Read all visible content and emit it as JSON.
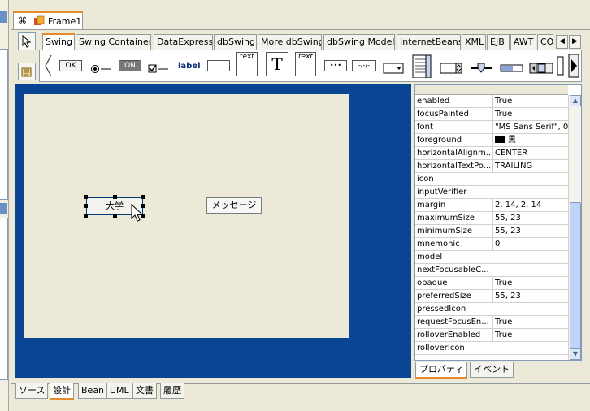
{
  "window": {
    "tab_title": "Frame1"
  },
  "palette_tabs": [
    {
      "label": "Swing",
      "active": true
    },
    {
      "label": "Swing Containers"
    },
    {
      "label": "DataExpress"
    },
    {
      "label": "dbSwing"
    },
    {
      "label": "More dbSwing"
    },
    {
      "label": "dbSwing Models"
    },
    {
      "label": "InternetBeans"
    },
    {
      "label": "XML"
    },
    {
      "label": "EJB"
    },
    {
      "label": "AWT"
    },
    {
      "label": "CO"
    }
  ],
  "palette": {
    "ok": "OK",
    "on": "ON",
    "label": "label",
    "text_field": "text",
    "text_pane": "text",
    "password": "•••",
    "formatted": "-/-/-",
    "big_t": "T"
  },
  "canvas": {
    "button_university": "大学",
    "button_message": "メッセージ"
  },
  "properties": [
    {
      "name": "enabled",
      "value": "True"
    },
    {
      "name": "focusPainted",
      "value": "True"
    },
    {
      "name": "font",
      "value": "\"MS Sans Serif\", 0"
    },
    {
      "name": "foreground",
      "value": "黒",
      "swatch": true
    },
    {
      "name": "horizontalAlignm...",
      "value": "CENTER"
    },
    {
      "name": "horizontalTextPo...",
      "value": "TRAILING"
    },
    {
      "name": "icon",
      "value": ""
    },
    {
      "name": "inputVerifier",
      "value": ""
    },
    {
      "name": "margin",
      "value": "2, 14, 2, 14"
    },
    {
      "name": "maximumSize",
      "value": "55, 23"
    },
    {
      "name": "minimumSize",
      "value": "55, 23"
    },
    {
      "name": "mnemonic",
      "value": "0"
    },
    {
      "name": "model",
      "value": ""
    },
    {
      "name": "nextFocusableC...",
      "value": ""
    },
    {
      "name": "opaque",
      "value": "True"
    },
    {
      "name": "preferredSize",
      "value": "55, 23"
    },
    {
      "name": "pressedIcon",
      "value": ""
    },
    {
      "name": "requestFocusEn...",
      "value": "True"
    },
    {
      "name": "rolloverEnabled",
      "value": "True"
    },
    {
      "name": "rolloverIcon",
      "value": ""
    }
  ],
  "inspector_tabs": [
    "プロパティ",
    "イベント"
  ],
  "view_tabs": [
    {
      "label": "ソース"
    },
    {
      "label": "設計",
      "active": true
    },
    {
      "label": "Bean"
    },
    {
      "label": "UML"
    },
    {
      "label": "文書"
    },
    {
      "label": "履歴"
    }
  ]
}
